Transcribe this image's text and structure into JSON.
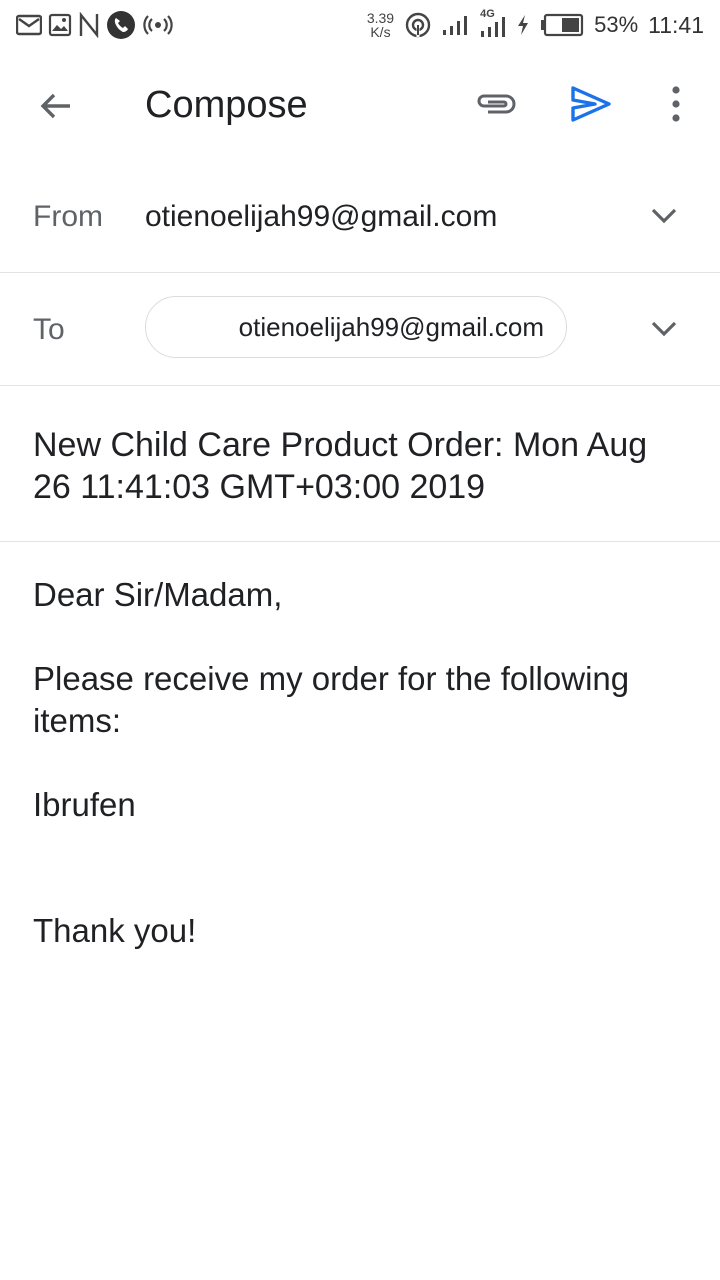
{
  "status_bar": {
    "net_speed_value": "3.39",
    "net_speed_unit": "K/s",
    "network_type": "4G",
    "battery_percent": "53%",
    "time": "11:41",
    "icons": [
      "gmail-icon",
      "gallery-icon",
      "nfc-icon",
      "call-icon",
      "hotspot-icon",
      "wifi-icon",
      "signal-icon",
      "signal-4g-icon",
      "charging-icon",
      "battery-icon"
    ]
  },
  "app_bar": {
    "title": "Compose",
    "icons": [
      "back-arrow-icon",
      "attach-icon",
      "send-icon",
      "more-vert-icon"
    ],
    "accent_color": "#1a73e8"
  },
  "from": {
    "label": "From",
    "value": "otienoelijah99@gmail.com"
  },
  "to": {
    "label": "To",
    "recipient": "otienoelijah99@gmail.com"
  },
  "subject": "New Child Care Product Order: Mon Aug 26 11:41:03 GMT+03:00 2019",
  "body": {
    "greeting": "Dear Sir/Madam,",
    "intro": "Please receive my order for the following items:",
    "item": "Ibrufen",
    "closing": "Thank you!"
  }
}
